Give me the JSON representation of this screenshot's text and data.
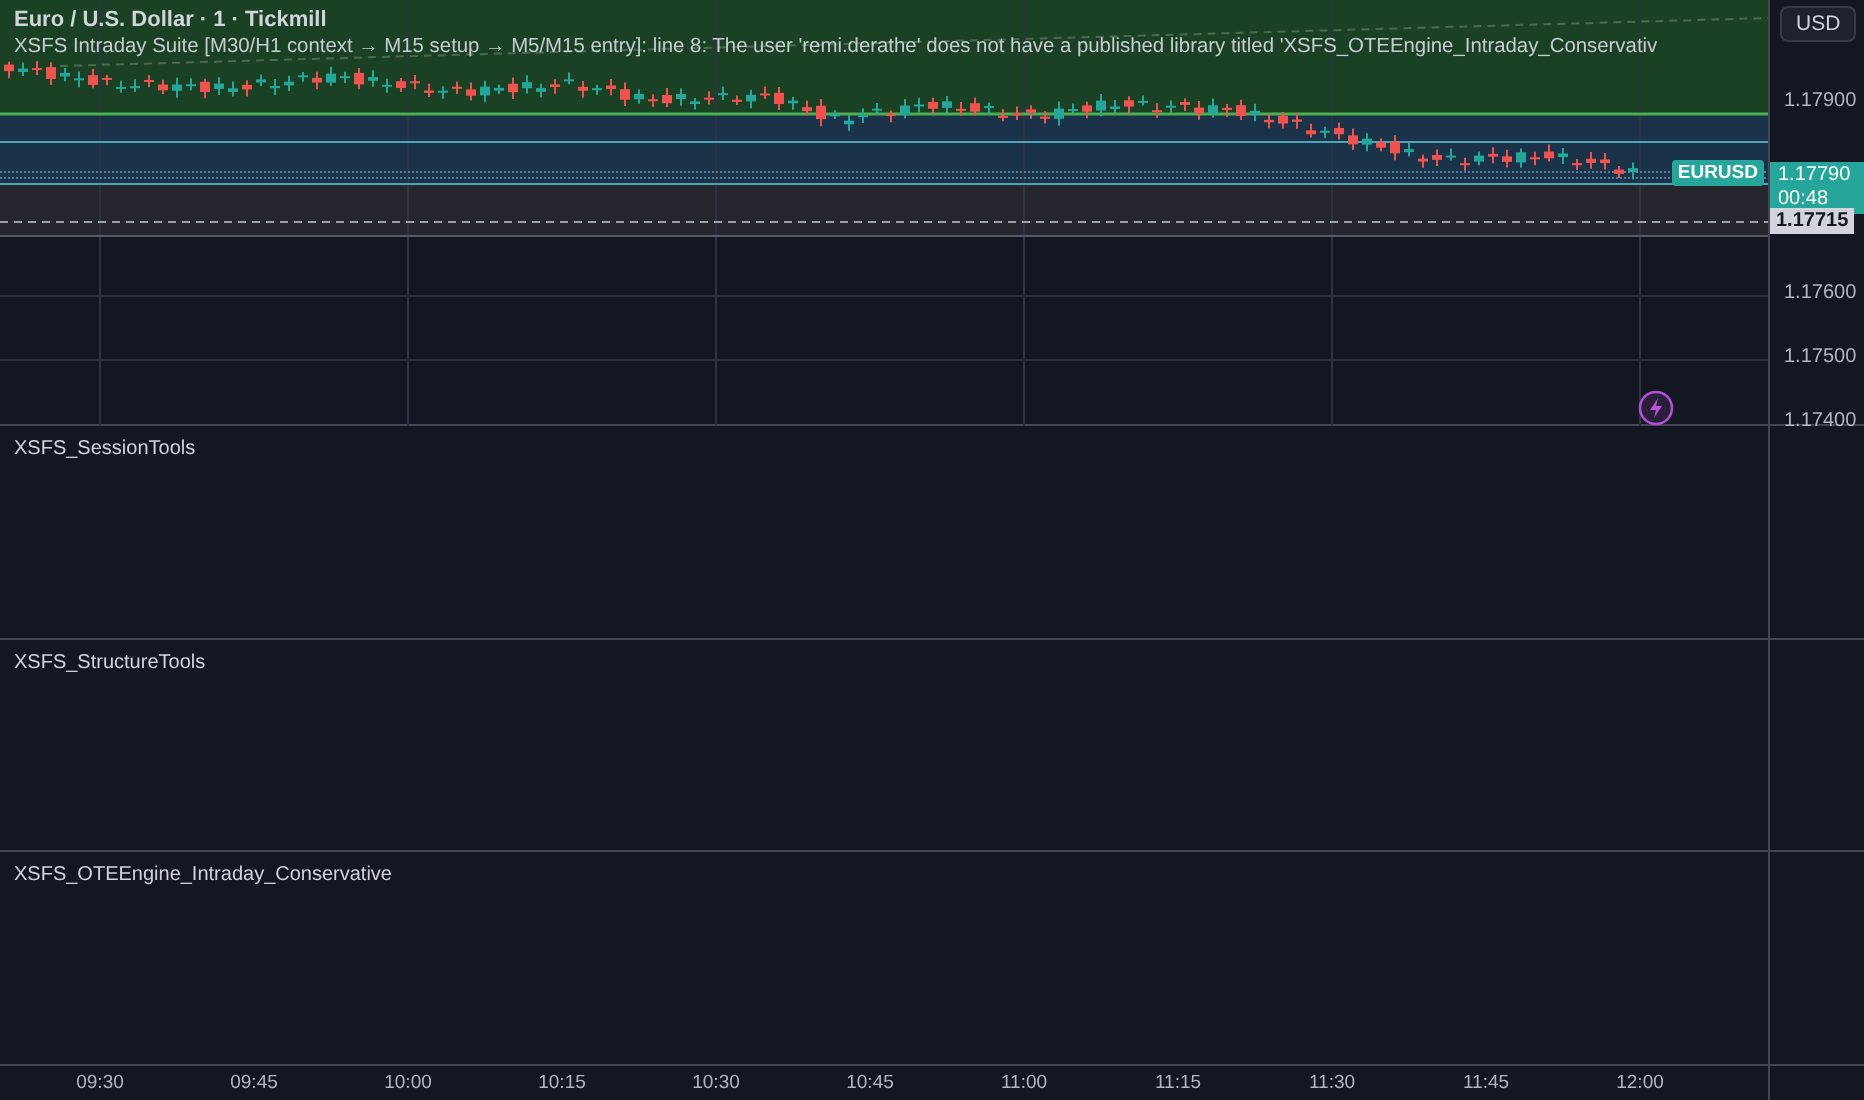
{
  "chart": {
    "symbol_title": "Euro / U.S. Dollar · 1 · Tickmill",
    "indicator_error": "XSFS Intraday Suite [M30/H1 context → M15 setup → M5/M15 entry]: line 8: The user 'remi.derathe' does not have a published library titled 'XSFS_OTEEngine_Intraday_Conservativ"
  },
  "price_axis": {
    "currency_button": "USD",
    "ticks": [
      "1.17900",
      "1.17600",
      "1.17500",
      "1.17400"
    ],
    "symbol_badge": "EURUSD",
    "last_price": "1.17790",
    "countdown": "00:48",
    "marker_price": "1.17715"
  },
  "panes": [
    {
      "title": "XSFS_SessionTools"
    },
    {
      "title": "XSFS_StructureTools"
    },
    {
      "title": "XSFS_OTEEngine_Intraday_Conservative"
    }
  ],
  "time_axis": {
    "labels": [
      "09:30",
      "09:45",
      "10:00",
      "10:15",
      "10:30",
      "10:45",
      "11:00",
      "11:15",
      "11:30",
      "11:45",
      "12:00"
    ]
  }
}
